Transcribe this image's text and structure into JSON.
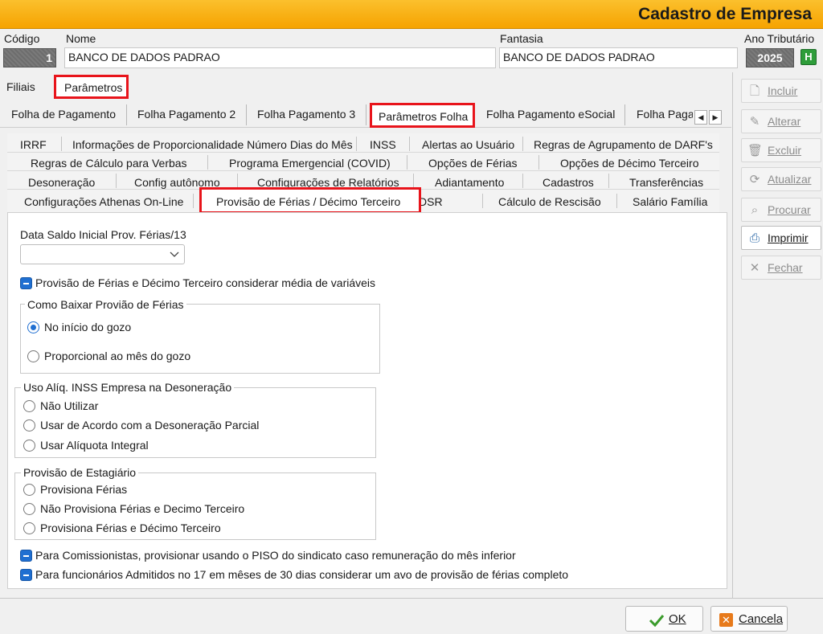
{
  "window": {
    "title": "Cadastro de Empresa"
  },
  "header": {
    "codigo_label": "Código",
    "codigo_value": "1",
    "nome_label": "Nome",
    "nome_value": "BANCO DE DADOS PADRAO",
    "fantasia_label": "Fantasia",
    "fantasia_value": "BANCO DE DADOS PADRAO",
    "ano_label": "Ano Tributário",
    "ano_value": "2025",
    "ano_badge": "H"
  },
  "top_tabs": [
    "Filiais",
    "Parâmetros"
  ],
  "sub_tabs": [
    "Folha de Pagamento",
    "Folha Pagamento 2",
    "Folha Pagamento 3",
    "Parâmetros Folha",
    "Folha Pagamento eSocial",
    "Folha Paga"
  ],
  "param_tabs": {
    "row1": [
      "IRRF",
      "Informações de Proporcionalidade Número Dias do Mês",
      "INSS",
      "Alertas ao Usuário",
      "Regras de Agrupamento de DARF's"
    ],
    "row2": [
      "Regras de Cálculo para Verbas",
      "Programa Emergencial (COVID)",
      "Opções de Férias",
      "Opções de Décimo Terceiro"
    ],
    "row3": [
      "Desoneração",
      "Config autônomo",
      "Configurações de Relatórios",
      "Adiantamento",
      "Cadastros",
      "Transferências"
    ],
    "row4": [
      "Configurações Athenas On-Line",
      "Provisão de Férias / Décimo Terceiro",
      "DSR",
      "Cálculo de Rescisão",
      "Salário Família"
    ]
  },
  "content": {
    "data_saldo_label": "Data Saldo Inicial Prov. Férias/13",
    "data_saldo_value": "",
    "chk_media": "Provisão de Férias e Décimo Terceiro  considerar média de variáveis",
    "group_baixar": {
      "title": "Como Baixar Provião de Férias",
      "options": [
        "No início do gozo",
        "Proporcional ao mês do gozo"
      ],
      "selected": "No início do gozo"
    },
    "group_inss": {
      "title": "Uso Alíq. INSS Empresa na Desoneração",
      "options": [
        "Não Utilizar",
        "Usar de Acordo com a Desoneração Parcial",
        "Usar Alíquota Integral"
      ]
    },
    "group_estagiario": {
      "title": "Provisão de Estagiário",
      "options": [
        "Provisiona Férias",
        "Não Provisiona Férias e Decimo Terceiro",
        "Provisiona Férias e Décimo Terceiro"
      ]
    },
    "chk_comissionistas": "Para Comissionistas, provisionar usando o PISO do sindicato caso remuneração do mês inferior",
    "chk_admitidos": "Para funcionários Admitidos no 17 em mêses de 30 dias considerar um avo de provisão de férias completo"
  },
  "sidebar": {
    "buttons": [
      {
        "label": "Incluir",
        "icon": "document-icon",
        "enabled": false
      },
      {
        "label": "Alterar",
        "icon": "edit-icon",
        "enabled": false
      },
      {
        "label": "Excluir",
        "icon": "trash-icon",
        "enabled": false
      },
      {
        "label": "Atualizar",
        "icon": "refresh-icon",
        "enabled": false
      },
      {
        "label": "Procurar",
        "icon": "binoculars-icon",
        "enabled": false
      },
      {
        "label": "Imprimir",
        "icon": "printer-icon",
        "enabled": true
      },
      {
        "label": "Fechar",
        "icon": "close-icon",
        "enabled": false
      }
    ]
  },
  "footer": {
    "ok_label": "OK",
    "cancel_label": "Cancela"
  },
  "colors": {
    "title_bar": "#f6a300",
    "highlight": "#e8141b",
    "accent": "#1f6fd1"
  }
}
